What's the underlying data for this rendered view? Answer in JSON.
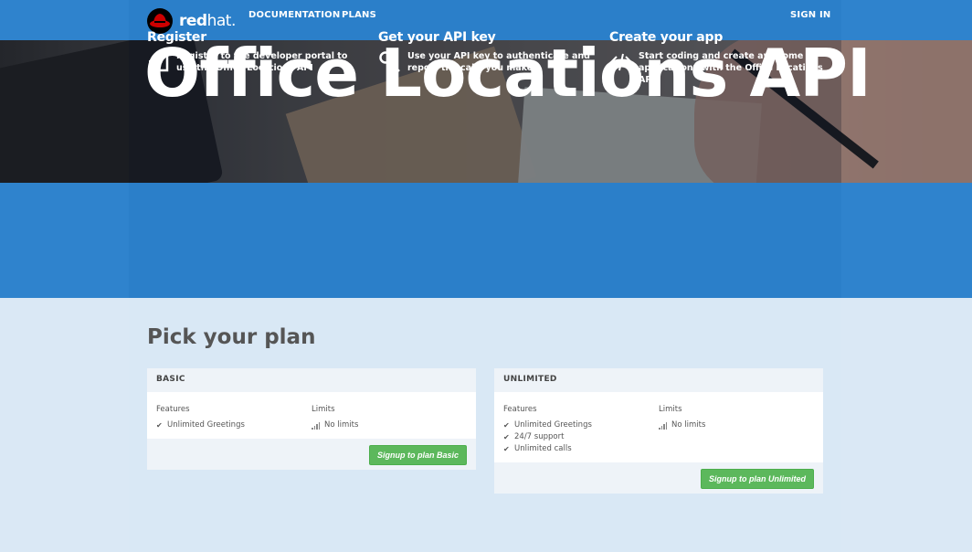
{
  "nav": {
    "logo_text_bold": "red",
    "logo_text_light": "hat.",
    "links": [
      "DOCUMENTATION",
      "PLANS"
    ],
    "sign_in": "SIGN IN"
  },
  "hero": {
    "title": "Office Locations API"
  },
  "features": [
    {
      "title": "Register",
      "text": "Register to the developer portal to use the Office Locations API",
      "icon": "sign-in-icon"
    },
    {
      "title": "Get your API key",
      "text": "Use your API key to authenticate and report the calls you make",
      "icon": "key-icon"
    },
    {
      "title": "Create your app",
      "text": "Start coding and create awesome applications with the Office Locations API",
      "icon": "code-icon"
    }
  ],
  "plans": {
    "title": "Pick your plan",
    "features_label": "Features",
    "limits_label": "Limits",
    "items": [
      {
        "name": "BASIC",
        "features": [
          "Unlimited Greetings"
        ],
        "limits": [
          "No limits"
        ],
        "button": "Signup to plan Basic"
      },
      {
        "name": "UNLIMITED",
        "features": [
          "Unlimited Greetings",
          "24/7 support",
          "Unlimited calls"
        ],
        "limits": [
          "No limits"
        ],
        "button": "Signup to plan Unlimited"
      }
    ]
  },
  "colors": {
    "primary": "#2b7fc9",
    "success": "#5cb85c",
    "brand_red": "#cc0000"
  }
}
